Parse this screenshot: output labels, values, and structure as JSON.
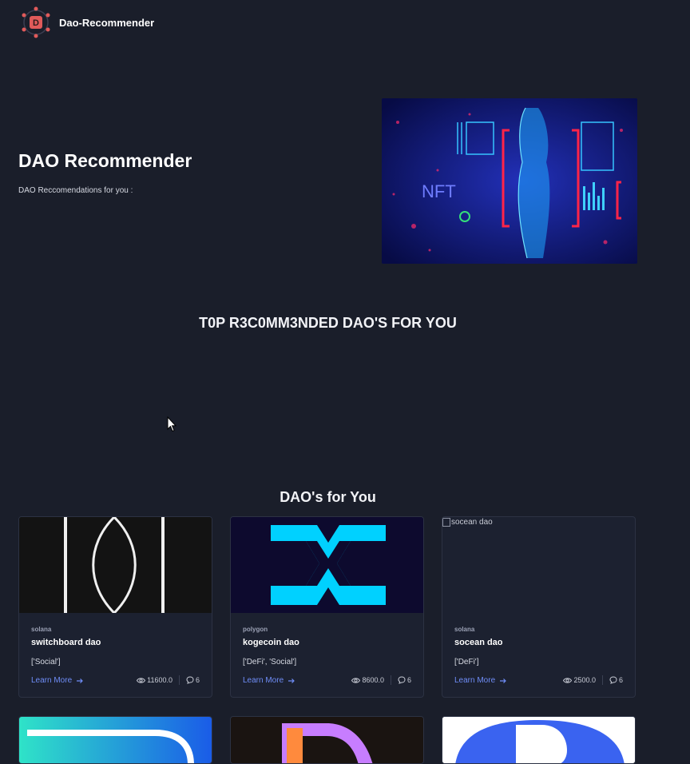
{
  "nav": {
    "brand": "Dao-Recommender",
    "logo_letter": "D"
  },
  "hero": {
    "title": "DAO Recommender",
    "subtitle": "DAO Reccomendations for you :",
    "image_text": "NFT"
  },
  "sections": {
    "top_heading": "T0P R3C0MM3NDED DAO'S FOR YOU",
    "daos_heading": "DAO's for You"
  },
  "cards": [
    {
      "chain": "solana",
      "name": "switchboard dao",
      "tags": "['Social']",
      "learn": "Learn More",
      "views": "11600.0",
      "comments": "6"
    },
    {
      "chain": "polygon",
      "name": "kogecoin dao",
      "tags": "['DeFi', 'Social']",
      "learn": "Learn More",
      "views": "8600.0",
      "comments": "6"
    },
    {
      "chain": "solana",
      "name": "socean dao",
      "tags": "['DeFi']",
      "learn": "Learn More",
      "views": "2500.0",
      "comments": "6",
      "image_alt": "socean dao"
    }
  ],
  "colors": {
    "background": "#1a1e2a",
    "card": "#1c2130",
    "link": "#6f8df7",
    "logo_accent": "#e05a5a"
  }
}
